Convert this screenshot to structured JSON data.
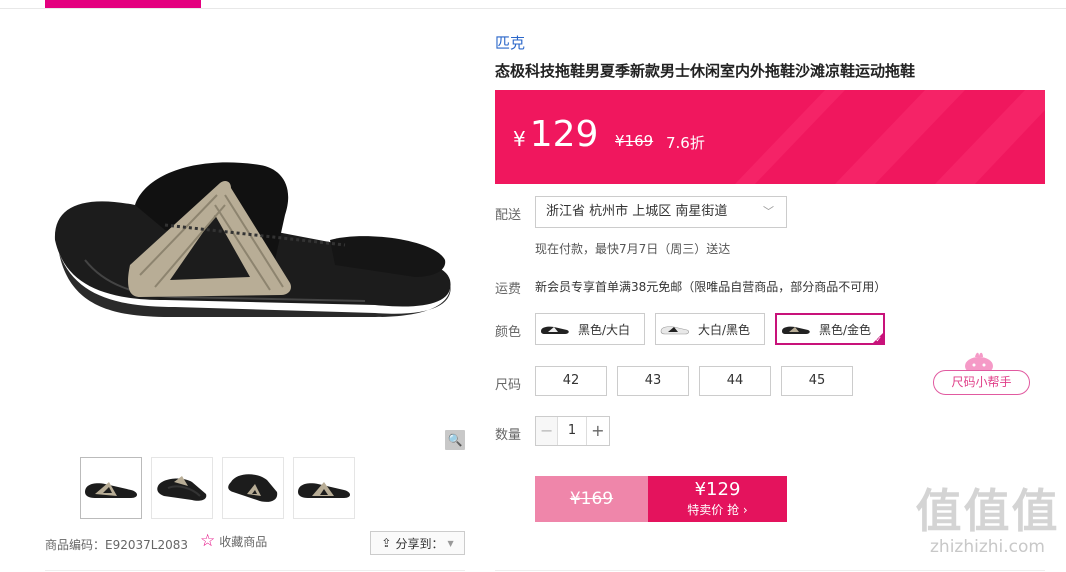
{
  "product": {
    "brand": "匹克",
    "title": "态极科技拖鞋男夏季新款男士休闲室内外拖鞋沙滩凉鞋运动拖鞋",
    "sku": "商品编码：E92037L2083",
    "favorite_label": "收藏商品",
    "share_label": "分享到："
  },
  "price": {
    "currency": "¥",
    "current": "129",
    "original": "¥169",
    "discount": "7.6折"
  },
  "delivery": {
    "label": "配送",
    "address": "浙江省 杭州市 上城区 南星街道",
    "eta": "现在付款，最快7月7日（周三）送达"
  },
  "shipping": {
    "label": "运费",
    "text": "新会员专享首单满38元免邮（限唯品自营商品，部分商品不可用）"
  },
  "color": {
    "label": "颜色",
    "options": [
      "黑色/大白",
      "大白/黑色",
      "黑色/金色"
    ],
    "selected": "黑色/金色"
  },
  "size": {
    "label": "尺码",
    "options": [
      "42",
      "43",
      "44",
      "45"
    ],
    "helper": "尺码小帮手"
  },
  "quantity": {
    "label": "数量",
    "minus": "−",
    "value": "1",
    "plus": "+"
  },
  "buy": {
    "original_price": "¥169",
    "special_price": "¥129",
    "label": "特卖价 抢 ›"
  },
  "watermark": {
    "big": "值值值",
    "small": "zhizhizhi.com"
  },
  "colors": {
    "accent": "#e4007f",
    "price_bg": "#f0175e",
    "buy_bg": "#e4135d",
    "orig_bg": "#ef86aa",
    "link_blue": "#2a66c9"
  }
}
